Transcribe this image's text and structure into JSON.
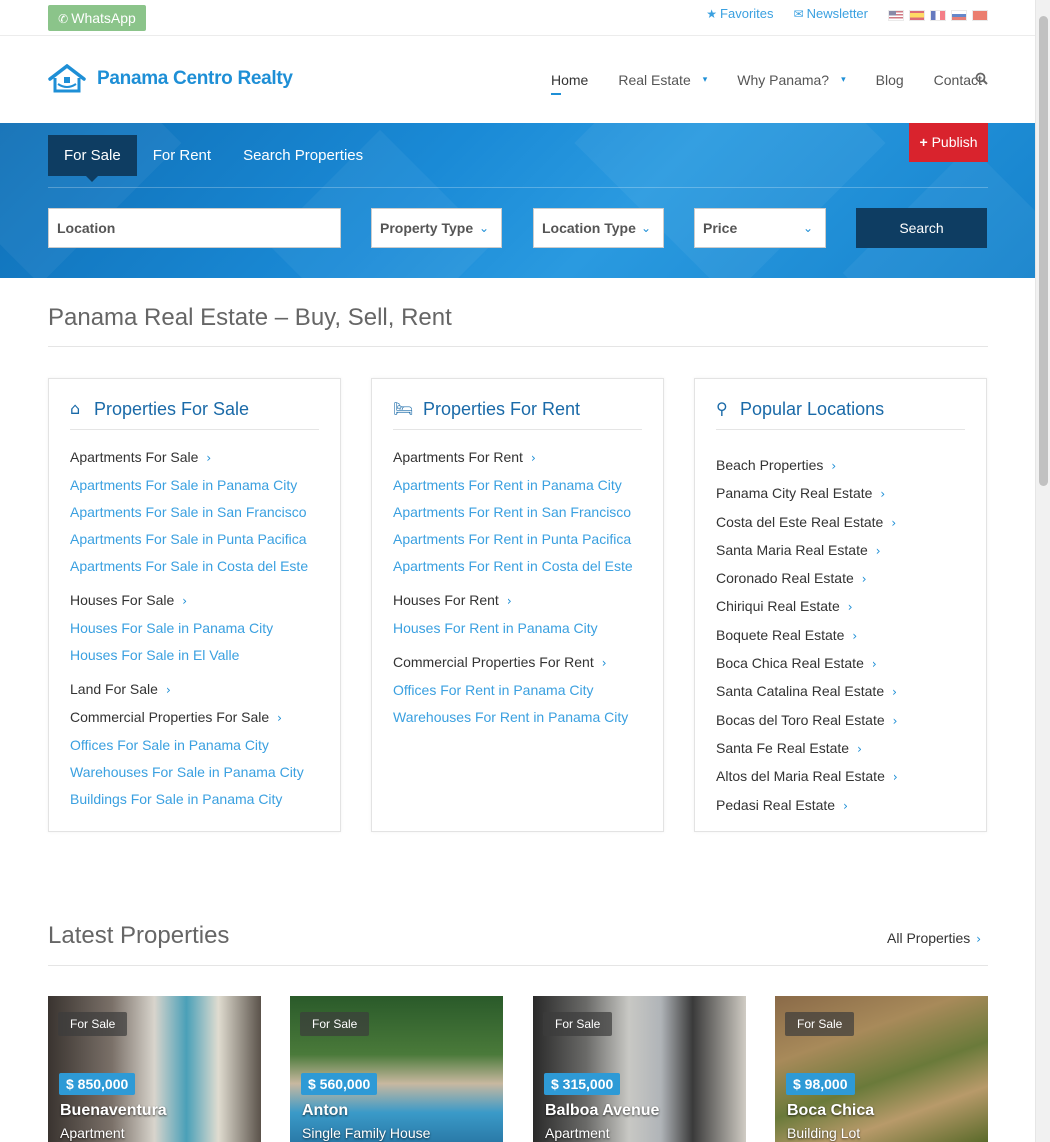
{
  "topbar": {
    "whatsapp": "WhatsApp",
    "favorites": "Favorites",
    "newsletter": "Newsletter",
    "languages": [
      "english-flag",
      "spanish-flag",
      "french-flag",
      "russian-flag",
      "chinese-flag"
    ]
  },
  "header": {
    "logo_text": "Panama Centro Realty",
    "nav": [
      "Home",
      "Real Estate",
      "Why Panama?",
      "Blog",
      "Contact"
    ]
  },
  "hero": {
    "tabs": [
      "For Sale",
      "For Rent",
      "Search Properties"
    ],
    "publish": "Publish",
    "location_placeholder": "Location",
    "property_type": "Property Type",
    "location_type": "Location Type",
    "price": "Price",
    "search": "Search"
  },
  "page_title": "Panama Real Estate – Buy, Sell, Rent",
  "sale_box": {
    "title": "Properties For Sale",
    "items": [
      {
        "label": "Apartments For Sale",
        "kind": "head"
      },
      {
        "label": "Apartments For Sale in Panama City",
        "kind": "sub"
      },
      {
        "label": "Apartments For Sale in San Francisco",
        "kind": "sub"
      },
      {
        "label": "Apartments For Sale in Punta Pacifica",
        "kind": "sub"
      },
      {
        "label": "Apartments For Sale in Costa del Este",
        "kind": "sub"
      },
      {
        "label": "Houses For Sale",
        "kind": "head"
      },
      {
        "label": "Houses For Sale in Panama City",
        "kind": "sub"
      },
      {
        "label": "Houses For Sale in El Valle",
        "kind": "sub"
      },
      {
        "label": "Land For Sale",
        "kind": "head"
      },
      {
        "label": "Commercial Properties For Sale",
        "kind": "head2"
      },
      {
        "label": "Offices For Sale in Panama City",
        "kind": "sub"
      },
      {
        "label": "Warehouses For Sale in Panama City",
        "kind": "sub"
      },
      {
        "label": "Buildings For Sale in Panama City",
        "kind": "sub"
      }
    ]
  },
  "rent_box": {
    "title": "Properties For Rent",
    "items": [
      {
        "label": "Apartments For Rent",
        "kind": "head"
      },
      {
        "label": "Apartments For Rent in Panama City",
        "kind": "sub"
      },
      {
        "label": "Apartments For Rent in San Francisco",
        "kind": "sub"
      },
      {
        "label": "Apartments For Rent in Punta Pacifica",
        "kind": "sub"
      },
      {
        "label": "Apartments For Rent in Costa del Este",
        "kind": "sub"
      },
      {
        "label": "Houses For Rent",
        "kind": "head"
      },
      {
        "label": "Houses For Rent in Panama City",
        "kind": "sub"
      },
      {
        "label": "Commercial Properties For Rent",
        "kind": "head"
      },
      {
        "label": "Offices For Rent in Panama City",
        "kind": "sub"
      },
      {
        "label": "Warehouses For Rent in Panama City",
        "kind": "sub"
      }
    ]
  },
  "locations_box": {
    "title": "Popular Locations",
    "items": [
      "Beach Properties",
      "Panama City Real Estate",
      "Costa del Este Real Estate",
      "Santa Maria Real Estate",
      "Coronado Real Estate",
      "Chiriqui Real Estate",
      "Boquete Real Estate",
      "Boca Chica Real Estate",
      "Santa Catalina Real Estate",
      "Bocas del Toro Real Estate",
      "Santa Fe Real Estate",
      "Altos del Maria Real Estate",
      "Pedasi Real Estate"
    ]
  },
  "latest": {
    "title": "Latest Properties",
    "all_link": "All Properties",
    "cards": [
      {
        "status": "For Sale",
        "price": "$ 850,000",
        "name": "Buenaventura",
        "type": "Apartment"
      },
      {
        "status": "For Sale",
        "price": "$ 560,000",
        "name": "Anton",
        "type": "Single Family House"
      },
      {
        "status": "For Sale",
        "price": "$ 315,000",
        "name": "Balboa Avenue",
        "type": "Apartment"
      },
      {
        "status": "For Sale",
        "price": "$ 98,000",
        "name": "Boca Chica",
        "type": "Building Lot"
      }
    ]
  }
}
